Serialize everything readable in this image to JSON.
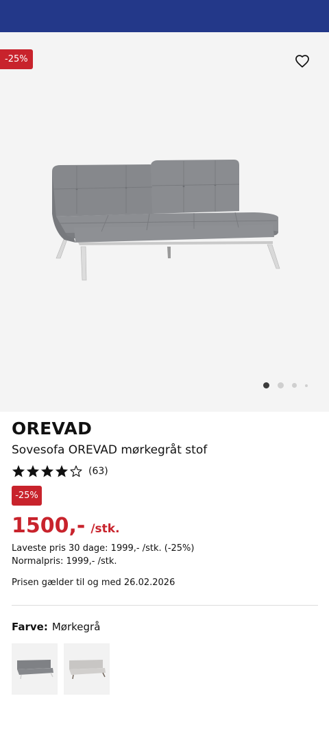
{
  "gallery": {
    "discount_flag": "-25%",
    "favorite_icon": "heart-outline-icon",
    "image": "grey-sofa-bed-photo",
    "slides": 4,
    "active_slide": 1
  },
  "product": {
    "brand": "OREVAD",
    "name": "Sovesofa OREVAD mørkegråt stof",
    "rating": 4.5,
    "rating_max": 5,
    "rating_count": "(63)",
    "discount_badge": "-25%",
    "price": "1500,-",
    "price_unit": "/stk.",
    "lowest_price_30_days": "Laveste pris 30 dage: 1999,- /stk. (-25%)",
    "normal_price": "Normalpris: 1999,- /stk.",
    "valid_until": "Prisen gælder til og med 26.02.2026"
  },
  "color": {
    "label": "Farve:",
    "value": "Mørkegrå",
    "options": [
      "Mørkegrå",
      "Lysegrå"
    ]
  },
  "colors": {
    "header": "#233889",
    "sale": "#c8232c",
    "gallery_bg": "#f4f4f4"
  }
}
